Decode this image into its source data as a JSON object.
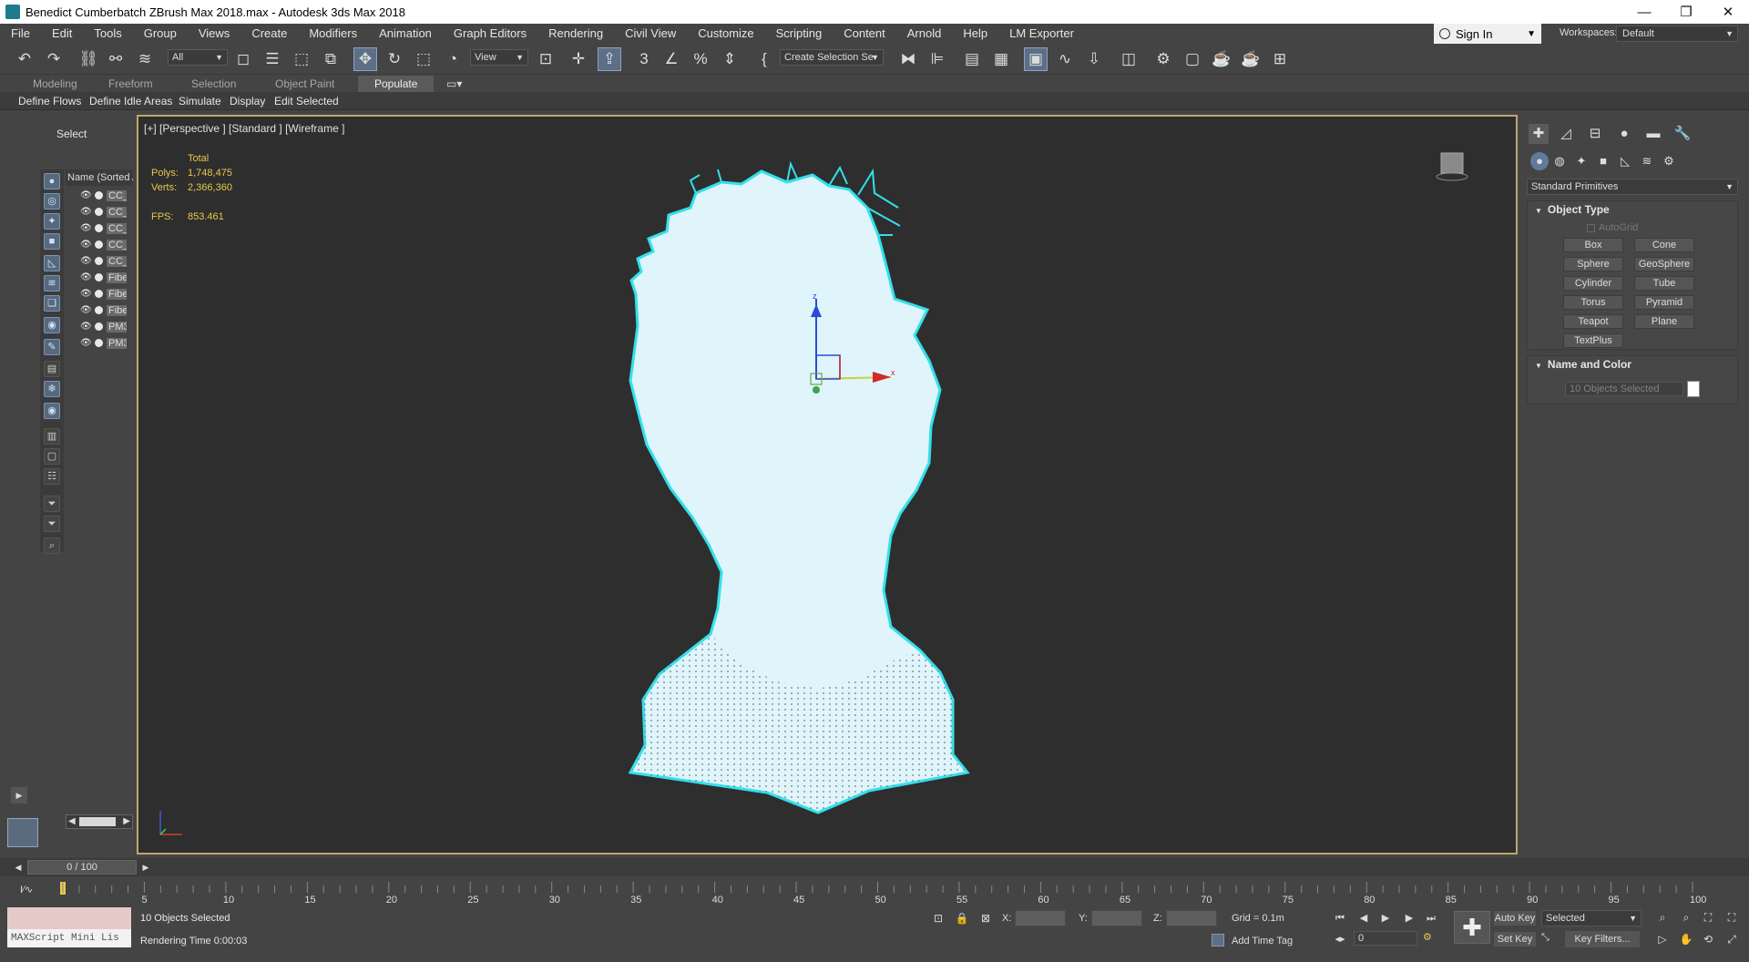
{
  "window": {
    "title": "Benedict Cumberbatch ZBrush Max 2018.max - Autodesk 3ds Max 2018",
    "minimize": "—",
    "restore": "❐",
    "close": "✕"
  },
  "menu": [
    "File",
    "Edit",
    "Tools",
    "Group",
    "Views",
    "Create",
    "Modifiers",
    "Animation",
    "Graph Editors",
    "Rendering",
    "Civil View",
    "Customize",
    "Scripting",
    "Content",
    "Arnold",
    "Help",
    "LM Exporter"
  ],
  "account": {
    "sign_in": "Sign In",
    "workspaces_label": "Workspaces:",
    "workspace_value": "Default"
  },
  "toolbar": {
    "selection_filter": "All",
    "ref_coord": "View",
    "named_selection": "Create Selection Se"
  },
  "ribbon": {
    "tabs": [
      "Modeling",
      "Freeform",
      "Selection",
      "Object Paint",
      "Populate"
    ],
    "active_tab": "Populate",
    "buttons": [
      "Define Flows",
      "Define Idle Areas",
      "Simulate",
      "Display",
      "Edit Selected"
    ]
  },
  "scene_explorer": {
    "mode": "Select",
    "column_header": "Name (Sorted A",
    "items": [
      "CC_",
      "CC_",
      "CC_",
      "CC_",
      "CC_",
      "Fibe",
      "Fibe",
      "Fibe",
      "PM3",
      "PM3"
    ]
  },
  "viewport": {
    "label": "[+] [Perspective ] [Standard ] [Wireframe ]",
    "stats": {
      "header": "Total",
      "polys_label": "Polys:",
      "polys": "1,748,475",
      "verts_label": "Verts:",
      "verts": "2,366,360",
      "fps_label": "FPS:",
      "fps": "853.461"
    },
    "gizmo_x": "x",
    "gizmo_z": "z"
  },
  "command_panel": {
    "category": "Standard Primitives",
    "object_type_title": "Object Type",
    "autogrid": "AutoGrid",
    "primitives": [
      "Box",
      "Cone",
      "Sphere",
      "GeoSphere",
      "Cylinder",
      "Tube",
      "Torus",
      "Pyramid",
      "Teapot",
      "Plane",
      "TextPlus"
    ],
    "name_color_title": "Name and Color",
    "name_field": "10 Objects Selected"
  },
  "timeline": {
    "frame_display": "0 / 100",
    "ticks": [
      "5",
      "10",
      "15",
      "20",
      "25",
      "30",
      "35",
      "40",
      "45",
      "50",
      "55",
      "60",
      "65",
      "70",
      "75",
      "80",
      "85",
      "90",
      "95",
      "100"
    ]
  },
  "status": {
    "maxscript": "MAXScript Mini Lis",
    "selection_info": "10 Objects Selected",
    "render_time": "Rendering Time  0:00:03",
    "x_label": "X:",
    "y_label": "Y:",
    "z_label": "Z:",
    "grid": "Grid = 0.1m",
    "add_time_tag": "Add Time Tag",
    "current_frame": "0",
    "auto_key": "Auto Key",
    "set_key": "Set Key",
    "key_mode": "Selected",
    "key_filters": "Key Filters..."
  },
  "colors": {
    "viewport_bg": "#2e2e2e",
    "viewport_border": "#bda76a",
    "mesh_fill": "#dff4fb",
    "mesh_edge": "#33e0ec",
    "stats_text": "#e8c84a"
  }
}
